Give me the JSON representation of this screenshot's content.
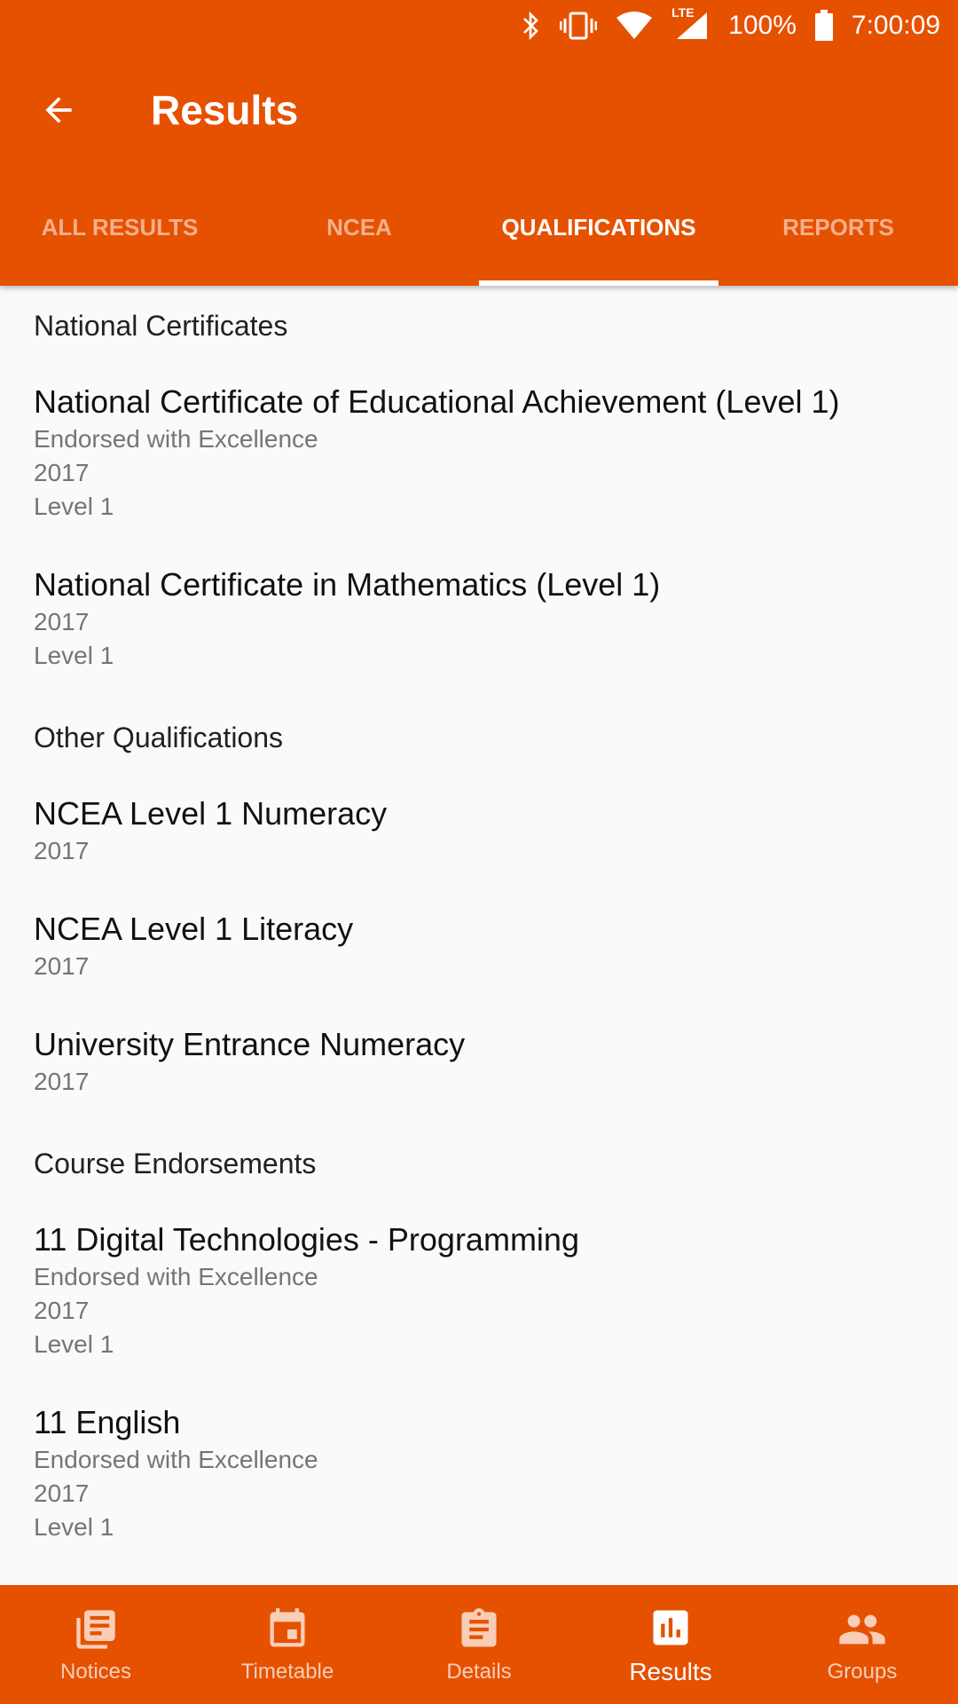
{
  "status": {
    "battery_percent": "100%",
    "time": "7:00:09",
    "network": "LTE",
    "icons": [
      "bluetooth-icon",
      "vibrate-icon",
      "wifi-icon",
      "signal-icon",
      "battery-icon"
    ]
  },
  "toolbar": {
    "title": "Results",
    "back_icon": "arrow-left-icon"
  },
  "tabs": [
    {
      "label": "ALL RESULTS",
      "active": false
    },
    {
      "label": "NCEA",
      "active": false
    },
    {
      "label": "QUALIFICATIONS",
      "active": true
    },
    {
      "label": "REPORTS",
      "active": false
    }
  ],
  "sections": [
    {
      "header": "National Certificates",
      "items": [
        {
          "title": "National Certificate of Educational Achievement (Level 1)",
          "lines": [
            "Endorsed with Excellence",
            "2017",
            "Level 1"
          ]
        },
        {
          "title": "National Certificate in Mathematics (Level 1)",
          "lines": [
            "2017",
            "Level 1"
          ]
        }
      ]
    },
    {
      "header": "Other Qualifications",
      "items": [
        {
          "title": "NCEA Level 1 Numeracy",
          "lines": [
            "2017"
          ]
        },
        {
          "title": "NCEA Level 1 Literacy",
          "lines": [
            "2017"
          ]
        },
        {
          "title": "University Entrance Numeracy",
          "lines": [
            "2017"
          ]
        }
      ]
    },
    {
      "header": "Course Endorsements",
      "items": [
        {
          "title": "11 Digital Technologies - Programming",
          "lines": [
            "Endorsed with Excellence",
            "2017",
            "Level 1"
          ]
        },
        {
          "title": "11 English",
          "lines": [
            "Endorsed with Excellence",
            "2017",
            "Level 1"
          ]
        }
      ]
    }
  ],
  "bottom_nav": [
    {
      "label": "Notices",
      "icon": "notices-icon",
      "active": false
    },
    {
      "label": "Timetable",
      "icon": "calendar-icon",
      "active": false
    },
    {
      "label": "Details",
      "icon": "clipboard-icon",
      "active": false
    },
    {
      "label": "Results",
      "icon": "bar-chart-icon",
      "active": true
    },
    {
      "label": "Groups",
      "icon": "people-icon",
      "active": false
    }
  ],
  "colors": {
    "primary": "#e65100",
    "background": "#fafafa",
    "secondary_text": "#757575"
  }
}
